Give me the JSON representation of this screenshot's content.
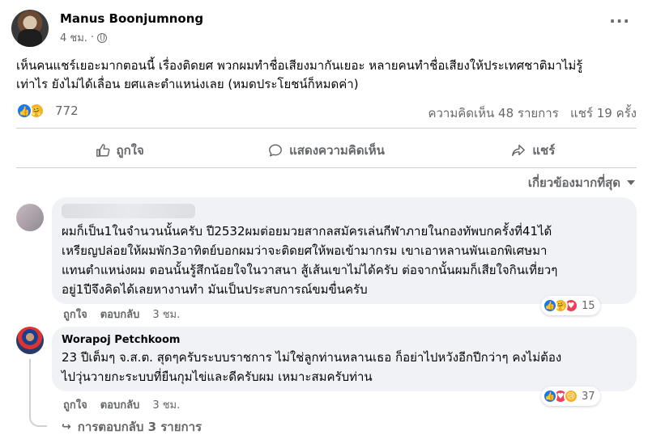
{
  "post": {
    "author": "Manus Boonjumnong",
    "time": "4 ชม.",
    "separator": "·",
    "text_line1": "เห็นคนแชร์เยอะมากตอนนี้ เรื่องติดยศ พวกผมทำชื่อเสียงมากันเยอะ หลายคนทำชื่อเสียงให้ประเทศชาติมาไม่รู้",
    "text_line2": "เท่าไร ยังไม่ได้เลื่อน ยศและตำแหน่งเลย (หมดประโยชน์ก็หมดค่า)"
  },
  "stats": {
    "reaction_count": "772",
    "comments": "ความคิดเห็น 48 รายการ",
    "shares": "แชร์ 19 ครั้ง"
  },
  "actions": {
    "like": "ถูกใจ",
    "comment": "แสดงความคิดเห็น",
    "share": "แชร์"
  },
  "sort": {
    "label": "เกี่ยวข้องมากที่สุด"
  },
  "comments": [
    {
      "name": "",
      "text_lines": [
        "ผมก็เป็น1ในจำนวนนั้นครับ ปี2532ผมต่อยมวยสากลสมัครเล่นกีฬาภายในกองทัพบกครั้งที่41ได้",
        "เหรียญปล่อยให้ผมพัก3อาทิตย์บอกผมว่าจะติดยศให้พอเข้ามากรม เขาเอาหลานพันเอกพิเศษมา",
        "แทนตำแหน่งผม ตอนนั้นรู้สึกน้อยใจในวาสนา สู้เส้นเขาไม่ได้ครับ ต่อจากนั้นผมก็เสียใจกินเที่ยวๆ",
        "อยู่1ปีจึงคิดได้เลยหางานทำ มันเป็นประสบการณ์ขมขื่นครับ"
      ],
      "like": "ถูกใจ",
      "reply": "ตอบกลับ",
      "time": "3 ชม.",
      "reaction_count": "15"
    },
    {
      "name": "Worapoj Petchkoom",
      "text_lines": [
        "23 ปีเต็มๆ จ.ส.ต. สุดๆครับระบบราชการ ไม่ใช่ลูกท่านหลานเธอ ก็อย่าไปหวังอีกปีกว่าๆ คงไม่ต้อง",
        "ไปวุ่นวายกะระบบที่ยืนกุมไข่และดีครับผม เหมาะสมครับท่าน"
      ],
      "like": "ถูกใจ",
      "reply": "ตอบกลับ",
      "time": "3 ชม.",
      "reaction_count": "37"
    }
  ],
  "replies_link": "การตอบกลับ 3 รายการ",
  "colors": {
    "like_blue": "#1877f2",
    "love_red": "#f33e58",
    "care_yellow": "#f7b125",
    "meta_gray": "#65676b",
    "bubble_bg": "#f0f2f5"
  },
  "icons": [
    "more-icon",
    "globe-icon",
    "like-icon",
    "comment-icon",
    "share-icon",
    "caret-down-icon",
    "reply-arrow-icon"
  ]
}
